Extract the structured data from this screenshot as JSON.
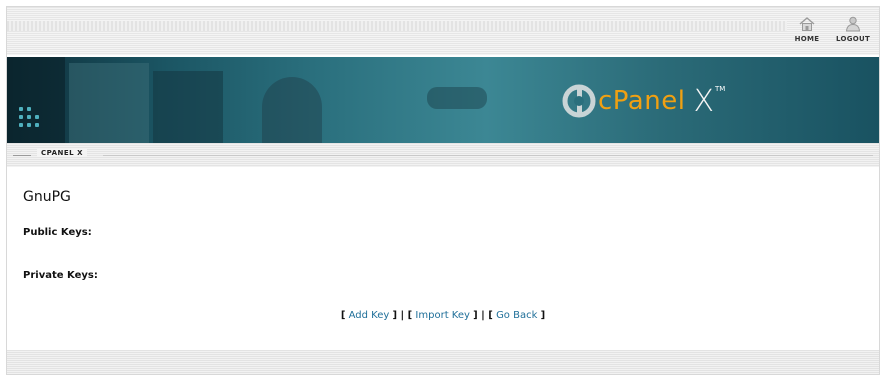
{
  "nav": {
    "home_label": "HOME",
    "logout_label": "LOGOUT",
    "home_icon": "home-icon",
    "logout_icon": "user-icon"
  },
  "banner": {
    "brand_text": "cPanel",
    "brand_suffix": "X",
    "trademark": "TM",
    "brand_color": "#f0a012"
  },
  "breadcrumb": {
    "label": "CPANEL X"
  },
  "main": {
    "title": "GnuPG",
    "public_keys_label": "Public Keys:",
    "private_keys_label": "Private Keys:"
  },
  "actions": {
    "add_key": "Add Key",
    "import_key": "Import Key",
    "go_back": "Go Back",
    "link_color": "#1f6f99"
  }
}
